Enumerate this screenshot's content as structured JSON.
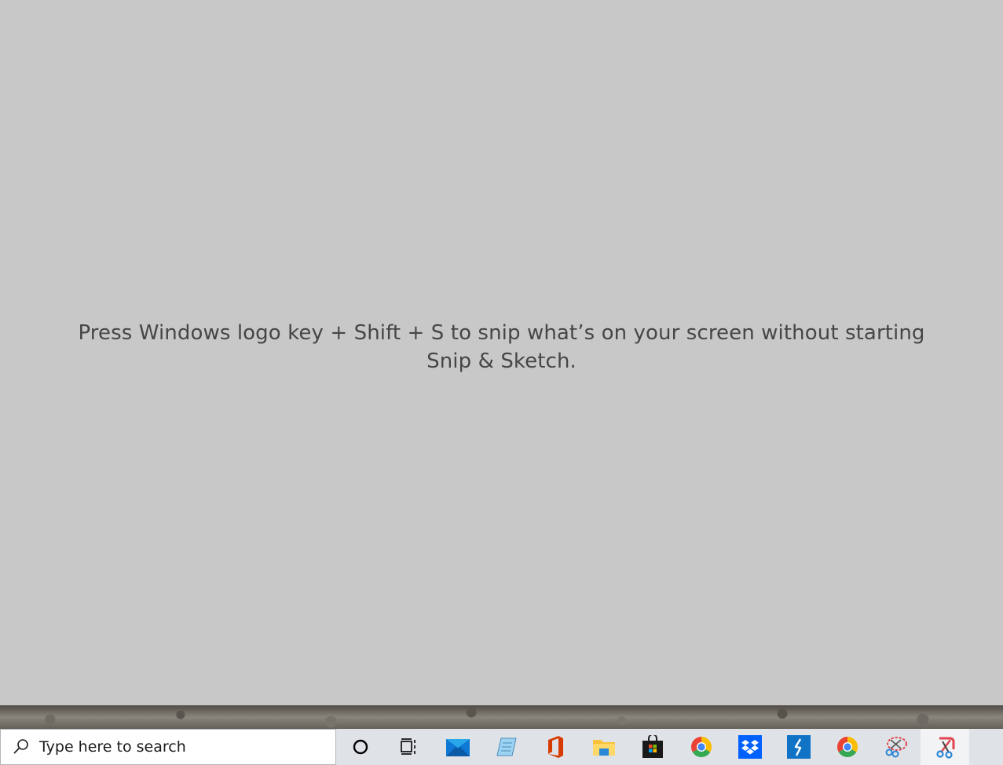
{
  "overlay": {
    "hint_text": "Press Windows logo key + Shift + S to snip what’s on your screen without starting Snip & Sketch."
  },
  "taskbar": {
    "search": {
      "placeholder": "Type here to search",
      "icon": "search-icon"
    },
    "buttons": [
      {
        "name": "cortana",
        "icon": "cortana-icon"
      },
      {
        "name": "task-view",
        "icon": "task-view-icon"
      },
      {
        "name": "mail",
        "icon": "mail-icon"
      },
      {
        "name": "notepad",
        "icon": "notepad-icon"
      },
      {
        "name": "office",
        "icon": "office-icon"
      },
      {
        "name": "file-explorer",
        "icon": "folder-icon"
      },
      {
        "name": "microsoft-store",
        "icon": "store-icon"
      },
      {
        "name": "chrome",
        "icon": "chrome-icon"
      },
      {
        "name": "dropbox",
        "icon": "dropbox-icon"
      },
      {
        "name": "app-lightning",
        "icon": "lightning-icon"
      },
      {
        "name": "chrome-2",
        "icon": "chrome-icon"
      },
      {
        "name": "snipping-tool",
        "icon": "snipping-tool-icon"
      },
      {
        "name": "snip-and-sketch",
        "icon": "snip-sketch-icon",
        "active": true
      }
    ]
  },
  "colors": {
    "overlay": "#c8c8c8",
    "hint_text": "#464646",
    "taskbar": "#dfe2e6",
    "active_button": "#f2f3f5",
    "mail_blue": "#0f78d4",
    "office_red": "#d83b01",
    "dropbox_blue": "#0061fe",
    "lightning_blue": "#1173c6"
  }
}
